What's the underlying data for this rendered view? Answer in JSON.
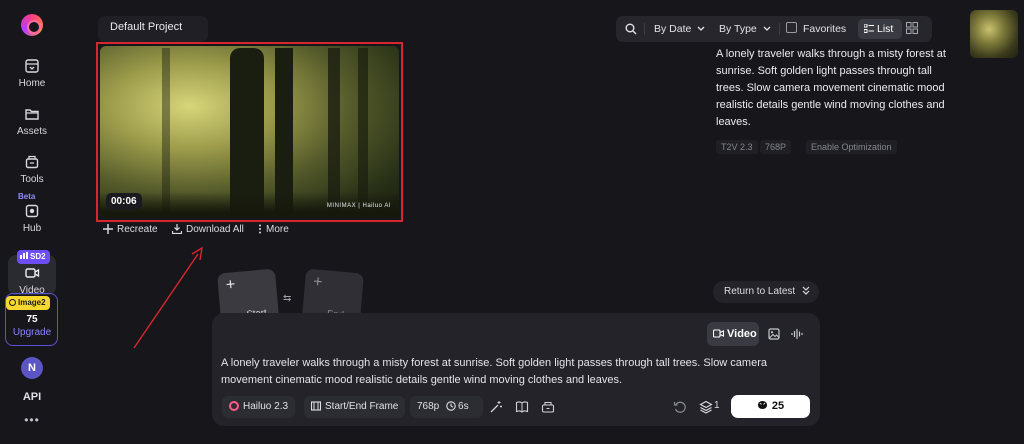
{
  "sidebar": {
    "items": [
      {
        "label": "Home",
        "icon": "home-icon"
      },
      {
        "label": "Assets",
        "icon": "folder-icon"
      },
      {
        "label": "Tools",
        "icon": "tools-icon"
      },
      {
        "label": "Hub",
        "icon": "hub-icon"
      },
      {
        "label": "Video",
        "icon": "video-icon"
      }
    ],
    "beta_label": "Beta",
    "video_badge": "SD2",
    "image_badge": "Image2",
    "credits": "75",
    "upgrade_label": "Upgrade",
    "avatar_initial": "N",
    "api_label": "API",
    "more_label": "•••"
  },
  "header": {
    "project": "Default Project",
    "sort_date": "By Date",
    "sort_type": "By Type",
    "favorites": "Favorites",
    "list_label": "List"
  },
  "video": {
    "duration": "00:06",
    "watermark": "MINIMAX | Hailuo AI",
    "actions": {
      "recreate": "Recreate",
      "download": "Download All",
      "more": "More"
    }
  },
  "detail": {
    "prompt": "A lonely traveler walks through a misty forest at sunrise. Soft golden light passes through tall trees. Slow camera movement cinematic mood realistic details gentle wind moving clothes and leaves.",
    "tags": [
      "T2V 2.3",
      "768P",
      "Enable Optimization"
    ]
  },
  "frames": {
    "start": "Start Frame",
    "end": "End Frame"
  },
  "return_label": "Return to Latest",
  "composer": {
    "mode_video": "Video",
    "prompt": "A lonely traveler walks through a misty forest at sunrise. Soft golden light passes through tall trees. Slow camera movement cinematic mood realistic details gentle wind moving clothes and leaves.",
    "model": "Hailuo 2.3",
    "frame_mode": "Start/End Frame",
    "resolution": "768p",
    "duration": "6s",
    "count": "1",
    "credits": "25"
  },
  "colors": {
    "highlight": "#d8262f",
    "accent": "#6d4df5",
    "badge": "#f6d92f"
  }
}
